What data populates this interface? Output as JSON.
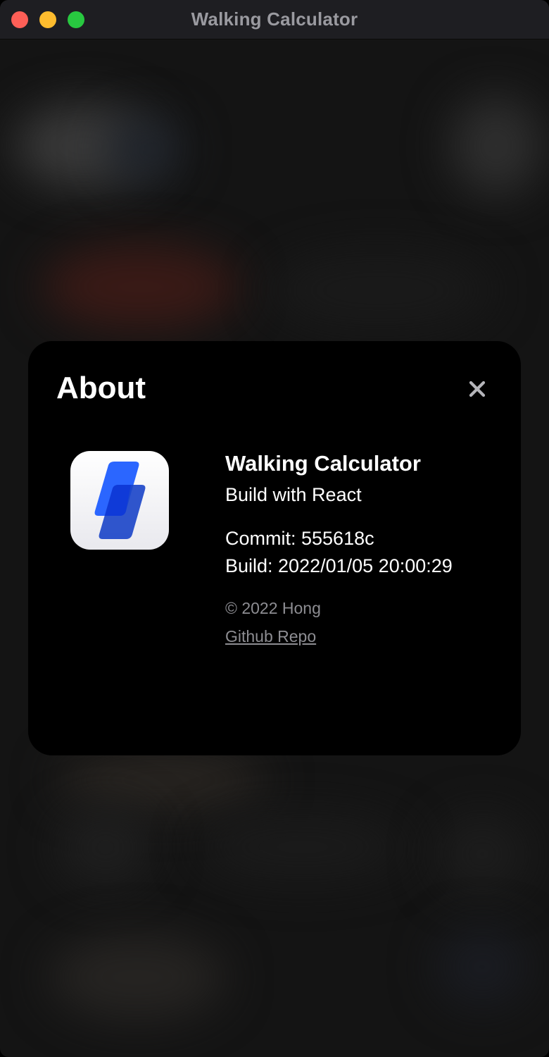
{
  "window": {
    "title": "Walking Calculator"
  },
  "about_dialog": {
    "heading": "About",
    "app_name": "Walking Calculator",
    "tagline": "Build with React",
    "commit_line": "Commit: 555618c",
    "build_line": "Build: 2022/01/05 20:00:29",
    "copyright": "© 2022 Hong",
    "repo_link_label": "Github Repo",
    "icons": {
      "close": "close-icon",
      "app_logo": "app-logo-icon"
    }
  },
  "colors": {
    "accent": "#1a5cf5",
    "dialog_background": "#000000",
    "window_background": "#141414",
    "traffic_close": "#fe5f57",
    "traffic_minimize": "#febc2e",
    "traffic_maximize": "#28c840",
    "muted_text": "#8d8d92"
  }
}
